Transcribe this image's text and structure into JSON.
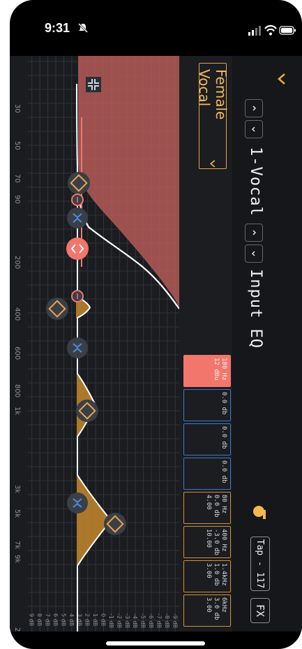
{
  "status_bar": {
    "time": "9:31"
  },
  "header": {
    "channel_name": "1-Vocal",
    "section_title": "Input EQ",
    "tap_label": "Tap - 117",
    "fx_label": "FX"
  },
  "preset": {
    "name": "Female Vocal"
  },
  "bands": [
    {
      "id": "hpf",
      "line1": "180 Hz",
      "line2": "12 dBu",
      "line3": "",
      "style": "red"
    },
    {
      "id": "b1",
      "line1": "0.0 db",
      "line2": "",
      "line3": "",
      "style": "blue"
    },
    {
      "id": "b2",
      "line1": "0.0 db",
      "line2": "",
      "line3": "",
      "style": "blue"
    },
    {
      "id": "b3",
      "line1": "0.0 db",
      "line2": "",
      "line3": "",
      "style": "blue"
    },
    {
      "id": "b4",
      "line1": "80 Hz",
      "line2": "0.0 db",
      "line3": "4.00",
      "style": "orange"
    },
    {
      "id": "b5",
      "line1": "400 Hz",
      "line2": "-3.0 db",
      "line3": "10.00",
      "style": "orange"
    },
    {
      "id": "b6",
      "line1": "1.4kHz",
      "line2": "1.0 db",
      "line3": "3.00",
      "style": "orange"
    },
    {
      "id": "b7",
      "line1": "6kHz",
      "line2": "3.0 db",
      "line3": "3.00",
      "style": "orange"
    }
  ],
  "graph": {
    "freq_labels": [
      "30",
      "50",
      "70",
      "90",
      "200",
      "400",
      "600",
      "800",
      "1k",
      "3k",
      "5k",
      "7k",
      "9k",
      "20k"
    ],
    "db_labels": [
      "9 dB",
      "8 dB",
      "7 dB",
      "6 dB",
      "5 dB",
      "4 dB",
      "3 dB",
      "2 dB",
      "1 dB",
      "0 dB",
      "-1 dB",
      "-2 dB",
      "-3 dB",
      "-4 dB",
      "-5 dB",
      "-6 dB",
      "-7 dB",
      "-8 dB",
      "-9 dB"
    ]
  },
  "colors": {
    "accent_orange": "#e6a548",
    "hpf_red": "#f2766c",
    "band_blue": "#3d79c9",
    "background": "#1b1d21"
  },
  "icons": [
    "silent-mode-icon",
    "signal-icon",
    "wifi-icon",
    "battery-icon",
    "collapse-icon",
    "up-chevron-icon",
    "down-chevron-icon",
    "compress-icon",
    "tap-tempo-icon"
  ]
}
